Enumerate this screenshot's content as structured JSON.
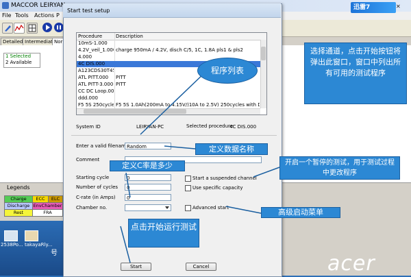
{
  "background_app": {
    "title": "MACCOR    LEIRYAN-",
    "menu": [
      "File",
      "Tools",
      "Actions",
      "P"
    ],
    "tabs": [
      "Detailed",
      "Intermediate",
      "Nor"
    ],
    "channel_status": {
      "selected": "1 Selected",
      "available": "2 Available"
    },
    "legends_label": "Legends",
    "legends": [
      {
        "label": "Charge",
        "color": "#55cc55"
      },
      {
        "label": "ECC",
        "color": "#f5d800"
      },
      {
        "label": "ELC",
        "color": "#cc9900"
      },
      {
        "label": "Discharge",
        "color": "#b8c8ff"
      },
      {
        "label": "EnvChamber",
        "color": "#e85cb8"
      },
      {
        "label": "Rest",
        "color": "#f5f53a"
      },
      {
        "label": "FRA",
        "color": "#ffffff"
      }
    ],
    "taskbar_items": [
      "2538Po...",
      "takayaRly..."
    ],
    "taskbar_glyph": "号",
    "wallpaper_brand": "acer"
  },
  "ad_widget": {
    "label": "迅雷7",
    "controls": "✕"
  },
  "dialog": {
    "title": "Start test setup",
    "procedure_list": {
      "headers": [
        "Procedure",
        "Description"
      ],
      "rows": [
        {
          "procedure": "10mS-1.000",
          "description": ""
        },
        {
          "procedure": "4.2V_veil_1.000",
          "description": "charge 950mA / 4.2V, disch C/5, 1C, 1.8A pls1 & pls2"
        },
        {
          "procedure": "4.000",
          "description": ""
        },
        {
          "procedure": "4C DIS.000",
          "description": "",
          "selected": true
        },
        {
          "procedure": "A123CDS30T45D",
          "description": ""
        },
        {
          "procedure": "ATL PITT.000",
          "description": "PITT"
        },
        {
          "procedure": "ATL PITT-3.000",
          "description": "PITT"
        },
        {
          "procedure": "CC DC Loop.000",
          "description": ""
        },
        {
          "procedure": "ddd.000",
          "description": ""
        },
        {
          "procedure": "F5 5S 250cycle",
          "description": "F5 5S 1.0Ah(200mA to 4.15V/)10A to 2.5V) 250cycles with DCr"
        }
      ]
    },
    "system_id_label": "System ID",
    "system_id": "LEIRYAN-PC",
    "selected_procedure_label": "Selected procedure",
    "selected_procedure": "4C DIS.000",
    "filename_label": "Enter a valid filename",
    "filename": "Random",
    "comment_label": "Comment",
    "comment": "",
    "starting_cycle_label": "Starting cycle",
    "starting_cycle": "0",
    "number_of_cycles_label": "Number of cycles",
    "number_of_cycles": "0",
    "crate_label": "C-rate (in Amps)",
    "crate": "0",
    "chamber_label": "Chamber no.",
    "chamber": "",
    "start_suspended_label": "Start a suspended channel",
    "use_specific_capacity_label": "Use specific capacity",
    "advanced_start_label": "Advanced start",
    "start_button": "Start",
    "cancel_button": "Cancel"
  },
  "annotations": {
    "channel_note": "选择通道，点击开始按钮将弹出此窗口，窗口中列出所有可用的测试程序",
    "proc_list_note": "程序列表",
    "filename_note": "定义数据名称",
    "crate_note": "定义C率是多少",
    "suspend_note": "开启一个暂停的测试，用于测试过程中更改程序",
    "advanced_note": "高级启动菜单",
    "start_note": "点击开始运行测试"
  }
}
